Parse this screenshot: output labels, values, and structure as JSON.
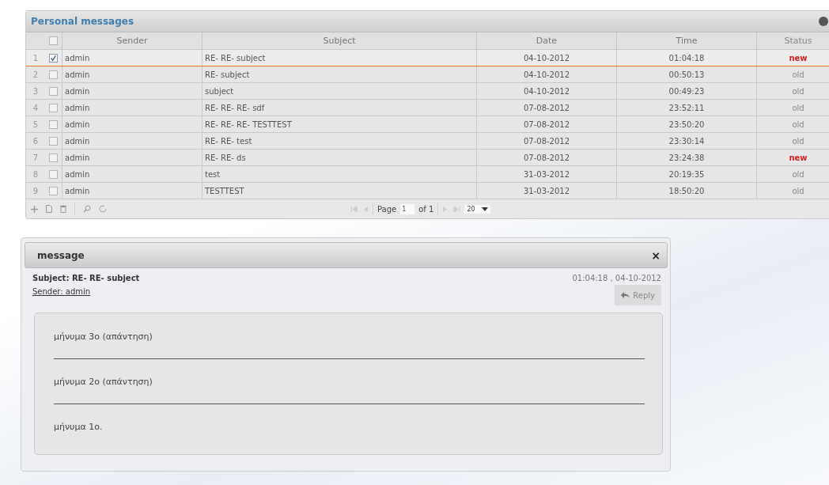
{
  "grid": {
    "title": "Personal messages",
    "columns": [
      "Sender",
      "Subject",
      "Date",
      "Time",
      "Status"
    ],
    "header_checked": false,
    "rows": [
      {
        "number": "1",
        "checked": true,
        "selected": true,
        "sender": "admin",
        "subject": "RE- RE- subject",
        "date": "04-10-2012",
        "time": "01:04:18",
        "status": "new",
        "unread": true
      },
      {
        "number": "2",
        "checked": false,
        "selected": false,
        "sender": "admin",
        "subject": "RE- subject",
        "date": "04-10-2012",
        "time": "00:50:13",
        "status": "old",
        "unread": false
      },
      {
        "number": "3",
        "checked": false,
        "selected": false,
        "sender": "admin",
        "subject": "subject",
        "date": "04-10-2012",
        "time": "00:49:23",
        "status": "old",
        "unread": false
      },
      {
        "number": "4",
        "checked": false,
        "selected": false,
        "sender": "admin",
        "subject": "RE- RE- RE- sdf",
        "date": "07-08-2012",
        "time": "23:52:11",
        "status": "old",
        "unread": false
      },
      {
        "number": "5",
        "checked": false,
        "selected": false,
        "sender": "admin",
        "subject": "RE- RE- RE- TESTTEST",
        "date": "07-08-2012",
        "time": "23:50:20",
        "status": "old",
        "unread": false
      },
      {
        "number": "6",
        "checked": false,
        "selected": false,
        "sender": "admin",
        "subject": "RE- RE- test",
        "date": "07-08-2012",
        "time": "23:30:14",
        "status": "old",
        "unread": false
      },
      {
        "number": "7",
        "checked": false,
        "selected": false,
        "sender": "admin",
        "subject": "RE- RE- ds",
        "date": "07-08-2012",
        "time": "23:24:38",
        "status": "new",
        "unread": true
      },
      {
        "number": "8",
        "checked": false,
        "selected": false,
        "sender": "admin",
        "subject": "test",
        "date": "31-03-2012",
        "time": "20:19:35",
        "status": "old",
        "unread": false
      },
      {
        "number": "9",
        "checked": false,
        "selected": false,
        "sender": "admin",
        "subject": "TESTTEST",
        "date": "31-03-2012",
        "time": "18:50:20",
        "status": "old",
        "unread": false
      }
    ],
    "pager": {
      "page_label": "Page",
      "page_value": "1",
      "of_label": "of 1",
      "page_size": "20"
    }
  },
  "message": {
    "title": "message",
    "close": "×",
    "subject": "Subject:  RE- RE- subject",
    "sender": "Sender:  admin",
    "timestamp": "01:04:18  , 04-10-2012",
    "reply": "Reply",
    "parts": [
      "μήνυμα 3ο (απάντηση)",
      "μήνυμα 2ο (απάντηση)",
      "μήνυμα 1ο."
    ]
  }
}
